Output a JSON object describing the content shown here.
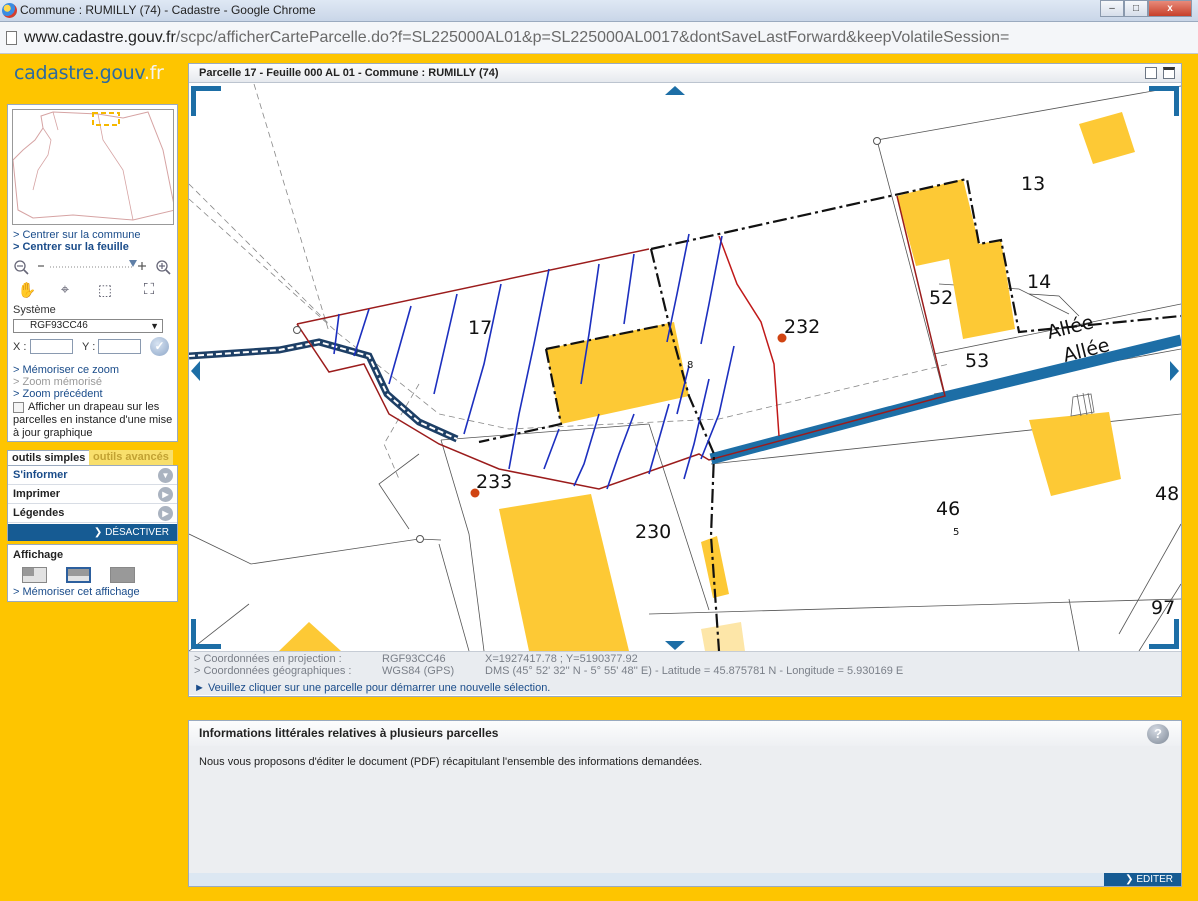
{
  "window": {
    "title": "Commune : RUMILLY (74) - Cadastre - Google Chrome",
    "url_prefix": "www.cadastre.gouv.fr",
    "url_rest": "/scpc/afficherCarteParcelle.do?f=SL225000AL01&p=SL225000AL0017&dontSaveLastForward&keepVolatileSession=",
    "controls": {
      "minimize": "–",
      "maximize": "□",
      "close": "x"
    }
  },
  "logo": {
    "main": "cadastre.gouv",
    "suffix": ".fr"
  },
  "sidebar": {
    "centrer_commune": "> Centrer sur la commune",
    "centrer_feuille": "> Centrer sur la feuille",
    "zoom_minus": "–",
    "zoom_plus": "+",
    "systeme_label": "Système",
    "systeme_value": "RGF93CC46",
    "x_label": "X :",
    "y_label": "Y :",
    "memoriser_zoom": "> Mémoriser ce zoom",
    "zoom_memorise": "> Zoom mémorisé",
    "zoom_precedent": "> Zoom précédent",
    "flag_checkbox_label": "Afficher un drapeau sur les parcelles en instance d'une mise à jour graphique"
  },
  "tools_tabs": {
    "simple": "outils simples",
    "advanced": "outils avancés"
  },
  "tools_menu": {
    "items": [
      "S'informer",
      "Imprimer",
      "Légendes"
    ],
    "deactivate": "DÉSACTIVER"
  },
  "affichage": {
    "title": "Affichage",
    "memoriser": "> Mémoriser cet affichage"
  },
  "map": {
    "header": "Parcelle 17 - Feuille 000 AL 01 - Commune : RUMILLY (74)",
    "labels": {
      "p13": "13",
      "p14": "14",
      "p52": "52",
      "p53": "53",
      "p17": "17",
      "p232": "232",
      "p8": "8",
      "p233": "233",
      "p230": "230",
      "p46": "46",
      "p5": "5",
      "p48": "48",
      "p97": "97",
      "allee1": "Allée",
      "allee2": "Allée"
    },
    "colors": {
      "building": "#fdc935",
      "road": "#1d6ea6",
      "parcel_outline": "#9b1c1c",
      "hydro": "#1c2fbf"
    }
  },
  "footer": {
    "proj_label": "> Coordonnées en projection :",
    "proj_system": "RGF93CC46",
    "proj_value": "X=1927417.78 ; Y=5190377.92",
    "geo_label": "> Coordonnées géographiques :",
    "geo_system": "WGS84 (GPS)",
    "geo_value": "DMS (45° 52' 32'' N - 5° 55' 48'' E) - Latitude = 45.875781 N - Longitude = 5.930169 E",
    "note": "► Veuillez cliquer sur une parcelle pour démarrer une nouvelle sélection."
  },
  "info": {
    "title": "Informations littérales relatives à plusieurs parcelles",
    "help": "?",
    "text": "Nous vous proposons d'éditer le document (PDF) récapitulant l'ensemble des informations demandées.",
    "editer": "EDITER"
  }
}
